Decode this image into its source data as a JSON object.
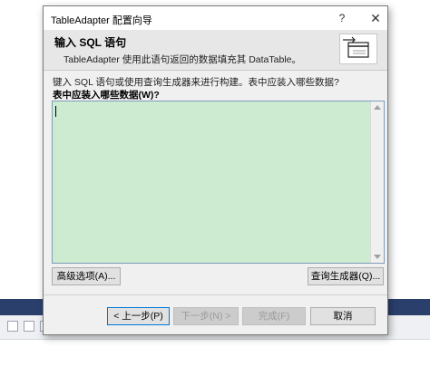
{
  "window": {
    "title": "TableAdapter 配置向导",
    "help_glyph": "?",
    "close_glyph": "✕"
  },
  "header": {
    "title": "输入 SQL 语句",
    "subtitle": "TableAdapter 使用此语句返回的数据填充其 DataTable。",
    "icon": "table-wizard-icon"
  },
  "body": {
    "prompt": "键入 SQL 语句或使用查询生成器来进行构建。表中应装入哪些数据?",
    "query_label": "表中应装入哪些数据(W)?",
    "sql_value": ""
  },
  "buttons": {
    "advanced": "高级选项(A)...",
    "query_builder": "查询生成器(Q)...",
    "previous": "< 上一步(P)",
    "next": "下一步(N) >",
    "finish": "完成(F)",
    "cancel": "取消"
  },
  "colors": {
    "sql_area_bg": "#cdebd1",
    "header_bg": "#e7e7e7",
    "background_band": "#2b3f6d"
  }
}
